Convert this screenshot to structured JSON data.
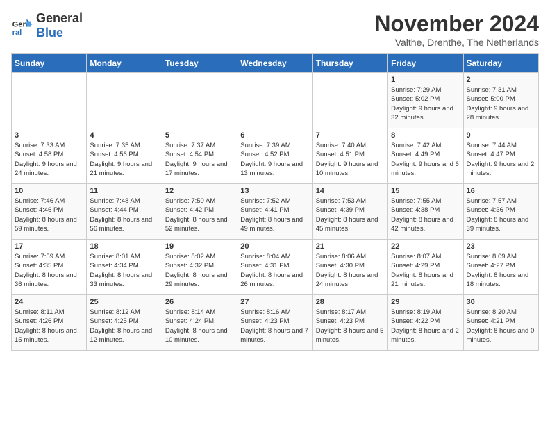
{
  "logo": {
    "text_general": "General",
    "text_blue": "Blue"
  },
  "header": {
    "month": "November 2024",
    "location": "Valthe, Drenthe, The Netherlands"
  },
  "days_of_week": [
    "Sunday",
    "Monday",
    "Tuesday",
    "Wednesday",
    "Thursday",
    "Friday",
    "Saturday"
  ],
  "weeks": [
    [
      {
        "day": "",
        "info": ""
      },
      {
        "day": "",
        "info": ""
      },
      {
        "day": "",
        "info": ""
      },
      {
        "day": "",
        "info": ""
      },
      {
        "day": "",
        "info": ""
      },
      {
        "day": "1",
        "info": "Sunrise: 7:29 AM\nSunset: 5:02 PM\nDaylight: 9 hours and 32 minutes."
      },
      {
        "day": "2",
        "info": "Sunrise: 7:31 AM\nSunset: 5:00 PM\nDaylight: 9 hours and 28 minutes."
      }
    ],
    [
      {
        "day": "3",
        "info": "Sunrise: 7:33 AM\nSunset: 4:58 PM\nDaylight: 9 hours and 24 minutes."
      },
      {
        "day": "4",
        "info": "Sunrise: 7:35 AM\nSunset: 4:56 PM\nDaylight: 9 hours and 21 minutes."
      },
      {
        "day": "5",
        "info": "Sunrise: 7:37 AM\nSunset: 4:54 PM\nDaylight: 9 hours and 17 minutes."
      },
      {
        "day": "6",
        "info": "Sunrise: 7:39 AM\nSunset: 4:52 PM\nDaylight: 9 hours and 13 minutes."
      },
      {
        "day": "7",
        "info": "Sunrise: 7:40 AM\nSunset: 4:51 PM\nDaylight: 9 hours and 10 minutes."
      },
      {
        "day": "8",
        "info": "Sunrise: 7:42 AM\nSunset: 4:49 PM\nDaylight: 9 hours and 6 minutes."
      },
      {
        "day": "9",
        "info": "Sunrise: 7:44 AM\nSunset: 4:47 PM\nDaylight: 9 hours and 2 minutes."
      }
    ],
    [
      {
        "day": "10",
        "info": "Sunrise: 7:46 AM\nSunset: 4:46 PM\nDaylight: 8 hours and 59 minutes."
      },
      {
        "day": "11",
        "info": "Sunrise: 7:48 AM\nSunset: 4:44 PM\nDaylight: 8 hours and 56 minutes."
      },
      {
        "day": "12",
        "info": "Sunrise: 7:50 AM\nSunset: 4:42 PM\nDaylight: 8 hours and 52 minutes."
      },
      {
        "day": "13",
        "info": "Sunrise: 7:52 AM\nSunset: 4:41 PM\nDaylight: 8 hours and 49 minutes."
      },
      {
        "day": "14",
        "info": "Sunrise: 7:53 AM\nSunset: 4:39 PM\nDaylight: 8 hours and 45 minutes."
      },
      {
        "day": "15",
        "info": "Sunrise: 7:55 AM\nSunset: 4:38 PM\nDaylight: 8 hours and 42 minutes."
      },
      {
        "day": "16",
        "info": "Sunrise: 7:57 AM\nSunset: 4:36 PM\nDaylight: 8 hours and 39 minutes."
      }
    ],
    [
      {
        "day": "17",
        "info": "Sunrise: 7:59 AM\nSunset: 4:35 PM\nDaylight: 8 hours and 36 minutes."
      },
      {
        "day": "18",
        "info": "Sunrise: 8:01 AM\nSunset: 4:34 PM\nDaylight: 8 hours and 33 minutes."
      },
      {
        "day": "19",
        "info": "Sunrise: 8:02 AM\nSunset: 4:32 PM\nDaylight: 8 hours and 29 minutes."
      },
      {
        "day": "20",
        "info": "Sunrise: 8:04 AM\nSunset: 4:31 PM\nDaylight: 8 hours and 26 minutes."
      },
      {
        "day": "21",
        "info": "Sunrise: 8:06 AM\nSunset: 4:30 PM\nDaylight: 8 hours and 24 minutes."
      },
      {
        "day": "22",
        "info": "Sunrise: 8:07 AM\nSunset: 4:29 PM\nDaylight: 8 hours and 21 minutes."
      },
      {
        "day": "23",
        "info": "Sunrise: 8:09 AM\nSunset: 4:27 PM\nDaylight: 8 hours and 18 minutes."
      }
    ],
    [
      {
        "day": "24",
        "info": "Sunrise: 8:11 AM\nSunset: 4:26 PM\nDaylight: 8 hours and 15 minutes."
      },
      {
        "day": "25",
        "info": "Sunrise: 8:12 AM\nSunset: 4:25 PM\nDaylight: 8 hours and 12 minutes."
      },
      {
        "day": "26",
        "info": "Sunrise: 8:14 AM\nSunset: 4:24 PM\nDaylight: 8 hours and 10 minutes."
      },
      {
        "day": "27",
        "info": "Sunrise: 8:16 AM\nSunset: 4:23 PM\nDaylight: 8 hours and 7 minutes."
      },
      {
        "day": "28",
        "info": "Sunrise: 8:17 AM\nSunset: 4:23 PM\nDaylight: 8 hours and 5 minutes."
      },
      {
        "day": "29",
        "info": "Sunrise: 8:19 AM\nSunset: 4:22 PM\nDaylight: 8 hours and 2 minutes."
      },
      {
        "day": "30",
        "info": "Sunrise: 8:20 AM\nSunset: 4:21 PM\nDaylight: 8 hours and 0 minutes."
      }
    ]
  ]
}
